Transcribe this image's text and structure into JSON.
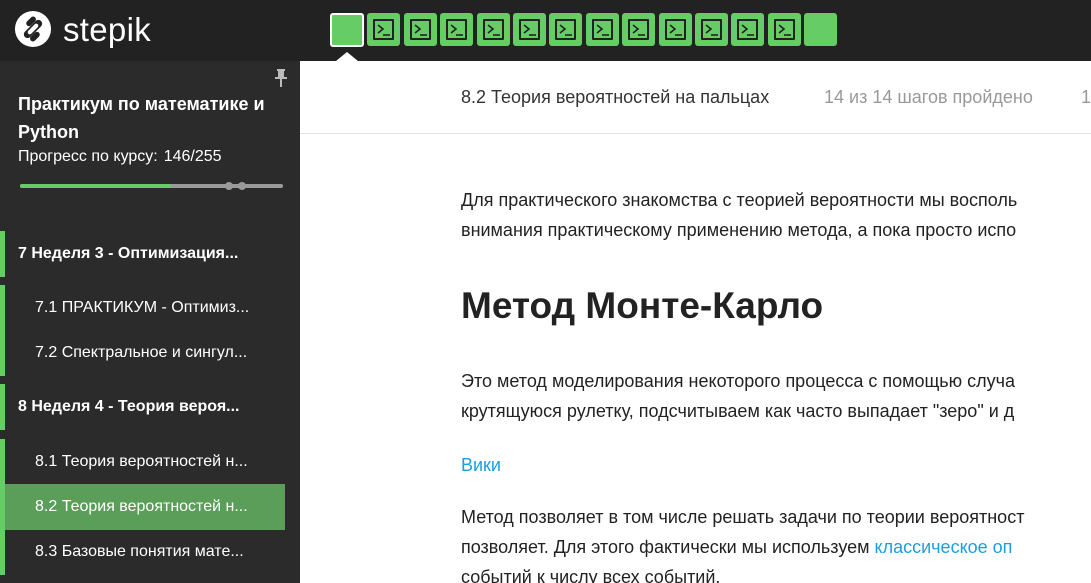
{
  "brand": {
    "name": "stepik"
  },
  "steps": {
    "count": 14,
    "current_index": 0,
    "items": [
      "text",
      "code",
      "code",
      "code",
      "code",
      "code",
      "code",
      "code",
      "code",
      "code",
      "code",
      "code",
      "code",
      "text"
    ]
  },
  "colors": {
    "accent": "#66cc66",
    "topbar": "#222222",
    "sidebar": "#2b2b2b",
    "active_row": "#5a9e5a",
    "link": "#1a9fe0"
  },
  "sidebar": {
    "course_title": "Практикум по математике и Python",
    "progress_label": "Прогресс по курсу:",
    "progress_value": "146/255",
    "progress_fraction": 0.5725,
    "toc": [
      {
        "type": "section",
        "label": "7  Неделя 3 - Оптимизация..."
      },
      {
        "type": "lesson",
        "label": "7.1  ПРАКТИКУМ - Оптимиз..."
      },
      {
        "type": "lesson",
        "label": "7.2  Спектральное и сингул..."
      },
      {
        "type": "section",
        "label": "8  Неделя 4 - Теория вероя..."
      },
      {
        "type": "lesson",
        "label": "8.1  Теория вероятностей н..."
      },
      {
        "type": "lesson",
        "label": "8.2  Теория вероятностей н...",
        "active": true
      },
      {
        "type": "lesson",
        "label": "8.3  Базовые понятия мате..."
      }
    ]
  },
  "lesson": {
    "title": "8.2 Теория вероятностей на пальцах",
    "progress": "14 из 14 шагов пройдено",
    "extra": "1"
  },
  "content": {
    "p1_line1": "Для практического знакомства с теорией вероятности мы восполь",
    "p1_line2": "внимания практическому применению метода, а пока просто испо",
    "heading": "Метод Монте-Карло",
    "p2_line1": "Это метод моделирования некоторого процесса с помощью случа",
    "p2_line2": "крутящуюся рулетку, подсчитываем как часто выпадает \"зеро\" и д",
    "wiki_link": "Вики",
    "p3_line1": "Метод позволяет в том числе решать задачи по теории вероятност",
    "p3_line2_before": "позволяет. Для этого фактически мы используем ",
    "p3_line2_link": "классическое оп",
    "p3_line3": "событий к числу всех событий."
  }
}
